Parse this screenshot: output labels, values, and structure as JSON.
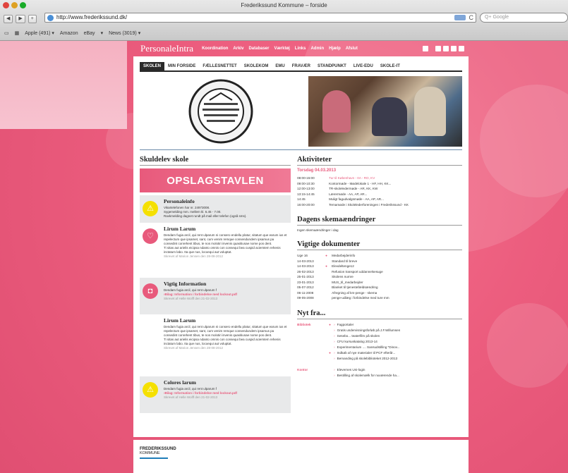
{
  "browser": {
    "title": "Frederikssund Kommune – forside",
    "url": "http://www.frederikssund.dk/",
    "search_placeholder": "Q+ Google",
    "bookmarks": [
      "Apple (491) ▾",
      "Amazon",
      "eBay",
      "▾",
      "News (3019) ▾"
    ]
  },
  "site": {
    "logo": "PersonaleIntra",
    "topnav": [
      "Koordination",
      "Arkiv",
      "Databaser",
      "Værktøj",
      "Links",
      "Admin",
      "Hjælp",
      "Afslut"
    ],
    "tabs": [
      "SKOLEN",
      "MIN FORSIDE",
      "FÆLLESNETTET",
      "SKOLEKOM",
      "EMU",
      "FRAVÆR",
      "STANDPUNKT",
      "LIVE-EDU",
      "SKOLE-IT"
    ],
    "active_tab": "SKOLEN"
  },
  "left": {
    "heading": "Skuldelev skole",
    "banner": "OPSLAGSTAVLEN",
    "posts": [
      {
        "title": "Personaleinfo",
        "body": "Vikartelefonen har nr. 24973008.",
        "body2": "Sygemelding mm. mellem kl. 6.45 - 7.00.",
        "body3": "Ravkmelding dagnet rundt på mail eller telefon (også sms).",
        "link": "",
        "meta": ""
      },
      {
        "title": "Lirum Larum",
        "body": "Dendam fugia arcil, qui rent ulparum ni consero endellu platur, sitatum que earum ius et repelectum que ipsamet, sant, cum venim remque consendundem ipsamus pa consedint conrehent tibus, te nos molotiri invenis quasitiusae nome pos dent.",
        "body2": "Ti sitas aut arielis eicipsa ndanto omnis con consequi bea cuspid aciemtem rehenis inctatum labo. Ita que nus, locoequi aut voluptat.",
        "body3": "",
        "link": "",
        "meta": "Skrevet af Marion Jensen den 28-08-2012"
      },
      {
        "title": "Vigtig Information",
        "body": "Dendam fugia arcil, qui rent ulparum f",
        "body2": "",
        "body3": "",
        "link": "›Bilag: Information i forbindelse med lockout.pdf",
        "meta": "Skrevet af Helle Wolff den 21-02-2013"
      },
      {
        "title": "Lirum Larum",
        "body": "Dendam fugia arcil, qui rent ulparum ni consero endellu platur, sitatum que earum ius et repelectum que ipsamet, sant, cum venim remque consendundem ipsamus pa consedint conrehent tibus, te nos molotiri invenis quasitiusae nome pos dent.",
        "body2": "Ti sitas aut arielis eicipsa ndanto omnis con consequi bea cuspid aciemtem rehenis inctatum labo. Ita que nus, locoequi aut voluptat.",
        "body3": "",
        "link": "",
        "meta": "Skrevet af Marion Jensen den 28-08-2012"
      },
      {
        "title": "Colores larum",
        "body": "Dendam fugia arcil, qui rent ulparum f",
        "body2": "",
        "body3": "",
        "link": "›Bilag: Information i forbindelse med lockout.pdf",
        "meta": "Skrevet af Helle Wolff den 21-02-2013"
      }
    ]
  },
  "aktiviteter": {
    "heading": "Aktiviteter",
    "date": "Torsdag 04.03.2013",
    "rows": [
      {
        "time": "08:00-15:00",
        "text": "Tur til København - 0A - RO, KV"
      },
      {
        "time": "09:00-10:30",
        "text": "Kontormøde - Mødelokale 1 - HF, HH, KK..."
      },
      {
        "time": "12:00-13:00",
        "text": "TR-skoleledermøde - AR, KK, KW"
      },
      {
        "time": "13:15-14:45",
        "text": "Lærermøde - AA, AP, AR..."
      },
      {
        "time": "14:45",
        "text": "Muligt fagudvalgsmøde - AA, AP, AR..."
      },
      {
        "time": "16:00-20:00",
        "text": "Temamøde i Skolelederforeningen i Frederikssund - KK"
      }
    ]
  },
  "skema": {
    "heading": "Dagens skemaændringer",
    "text": "Ingen skemaændringer i dag"
  },
  "dokumenter": {
    "heading": "Vigtige dokumenter",
    "rows": [
      {
        "date": "Uge 16",
        "dot": "●",
        "text": "Medarbejderinfo"
      },
      {
        "date": "14-03-2013",
        "dot": "",
        "text": "Standard til breve"
      },
      {
        "date": "14-03-2013",
        "dot": "●",
        "text": "Elevdeltenge12"
      },
      {
        "date": "26-02-2013",
        "dot": "",
        "text": "Refusion transport uddannelsesuge"
      },
      {
        "date": "25-01-2013",
        "dot": "",
        "text": "Skolens numre"
      },
      {
        "date": "23-01-2013",
        "dot": "",
        "text": "MUS_til_medarbejder"
      },
      {
        "date": "05-07-2012",
        "dot": "",
        "text": "Blanket til tjenestefældsændring"
      },
      {
        "date": "06-11-2008",
        "dot": "",
        "text": "Afregning af km-penge - skema"
      },
      {
        "date": "09-05-2008",
        "dot": "",
        "text": "penge-udlæg i forbindelse med ture mm"
      }
    ]
  },
  "nyt": {
    "heading": "Nyt fra...",
    "groups": [
      {
        "cat": "Bibliotek",
        "items": [
          {
            "dot": "●",
            "text": "Fagportaler"
          },
          {
            "dot": "",
            "text": "Gratis undervisningsforløb på J.F.Willumsen"
          },
          {
            "dot": "",
            "text": "Sesebo... teaterfilm på skolen"
          },
          {
            "dot": "",
            "text": "CFU kursuskatalog 2013-14"
          },
          {
            "dot": "",
            "text": "Experimentarium .... Sansudstilling \"Dinov..."
          },
          {
            "dot": "●",
            "text": "Indkøb af nye materialer til PCF efterår..."
          },
          {
            "dot": "",
            "text": "Bemanding på skolebiblioteket 2012-2013"
          }
        ]
      },
      {
        "cat": "Kontor",
        "items": [
          {
            "dot": "",
            "text": "Elevernes Uni-login"
          },
          {
            "dot": "",
            "text": "Bestilling af skolemælk for nuværende ha..."
          }
        ]
      }
    ]
  },
  "footer": {
    "line1": "FREDERIKSSUND",
    "line2": "KOMMUNE"
  }
}
